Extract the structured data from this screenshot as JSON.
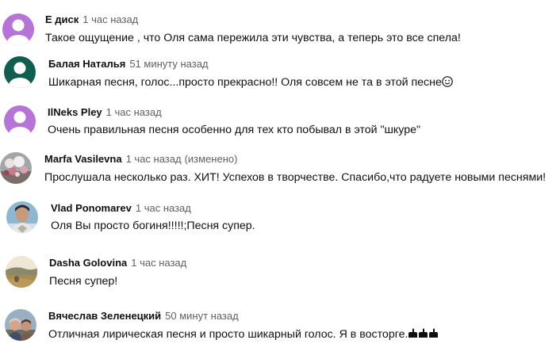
{
  "colors": {
    "author": "#0f0f0f",
    "meta": "#606060",
    "avatar_purple": "#b574d6",
    "avatar_teal": "#115d4f"
  },
  "comments": [
    {
      "author": "Е диск",
      "time": "1 час назад",
      "text": "Такое ощущение , что Оля сама пережила эти чувства, а теперь это все спела!",
      "avatar": "default-purple-avatar"
    },
    {
      "author": "Балая Наталья",
      "time": "51 минуту назад",
      "text": "Шикарная песня, голос...просто прекрасно!! Оля совсем не та в этой песне",
      "emoji": "smiling-face-emoji",
      "avatar": "default-teal-avatar"
    },
    {
      "author": "IlNeks Pley",
      "time": "1 час назад",
      "text": "Очень правильная песня особенно для тех кто побывал в этой \"шкуре\"",
      "avatar": "default-purple-avatar"
    },
    {
      "author": "Marfa Vasilevna",
      "time": "1 час назад",
      "edited": "(изменено)",
      "text": "Прослушала несколько раз. ХИТ! Успехов в творчестве. Спасибо,что радуете новыми песнями!",
      "avatar": "flowers-photo-avatar"
    },
    {
      "author": "Vlad Ponomarev",
      "time": "1 час назад",
      "text": "Оля Вы просто богиня!!!!!;Песня супер.",
      "avatar": "man-photo-avatar"
    },
    {
      "author": "Dasha Golovina",
      "time": "1 час назад",
      "text": "Песня супер!",
      "avatar": "landscape-photo-avatar"
    },
    {
      "author": "Вячеслав Зеленецкий",
      "time": "50 минут назад",
      "text": "Отличная лирическая песня и просто шикарный голос. Я в восторге.",
      "emoji": "pointing-hands-emoji",
      "avatar": "people-photo-avatar"
    }
  ]
}
